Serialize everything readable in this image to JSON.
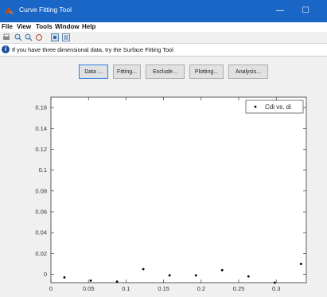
{
  "window": {
    "title": "Curve Fitting Tool",
    "minimize_glyph": "—",
    "maximize_glyph": "☐"
  },
  "menu": [
    "File",
    "View",
    "Tools",
    "Window",
    "Help"
  ],
  "toolbar_icons": [
    "print-icon",
    "zoom-in-icon",
    "zoom-out-icon",
    "pan-icon",
    "data-cursor-icon",
    "legend-icon"
  ],
  "info": {
    "text": "If you have three dimensional data, try the Surface Fitting Tool"
  },
  "buttons": [
    "Data ...",
    "Fitting...",
    "Exclude...",
    "Plotting...",
    "Analysis..."
  ],
  "chart_data": {
    "type": "scatter",
    "series": [
      {
        "name": "Cdi vs. di",
        "x": [
          0.018,
          0.053,
          0.088,
          0.123,
          0.158,
          0.193,
          0.228,
          0.263,
          0.298,
          0.333
        ],
        "y": [
          -0.003,
          -0.006,
          -0.007,
          0.005,
          -0.001,
          -0.001,
          0.004,
          -0.002,
          -0.008,
          0.01
        ]
      }
    ],
    "xlim": [
      0,
      0.34
    ],
    "ylim": [
      -0.008,
      0.17
    ],
    "xticks": [
      0,
      0.05,
      0.1,
      0.15,
      0.2,
      0.25,
      0.3
    ],
    "yticks": [
      0,
      0.02,
      0.04,
      0.06,
      0.08,
      0.1,
      0.12,
      0.14,
      0.16
    ],
    "legend": "top-right",
    "grid": false
  }
}
